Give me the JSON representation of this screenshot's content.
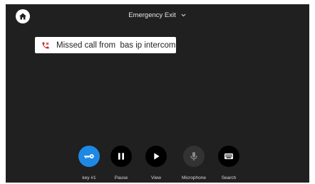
{
  "header": {
    "title": "Emergency Exit"
  },
  "notification": {
    "text": "Missed call from  bas ip intercom"
  },
  "controls": [
    {
      "label": "key #1",
      "icon": "key-icon",
      "color": "#1e88e5"
    },
    {
      "label": "Pause",
      "icon": "pause-icon",
      "color": "#000000"
    },
    {
      "label": "View",
      "icon": "play-icon",
      "color": "#000000"
    },
    {
      "label": "Microphone",
      "icon": "microphone-icon",
      "color": "#333333"
    },
    {
      "label": "Search",
      "icon": "keyboard-icon",
      "color": "#000000"
    }
  ],
  "colors": {
    "background": "#202020",
    "accent": "#1e88e5",
    "missed_call": "#c62828"
  }
}
